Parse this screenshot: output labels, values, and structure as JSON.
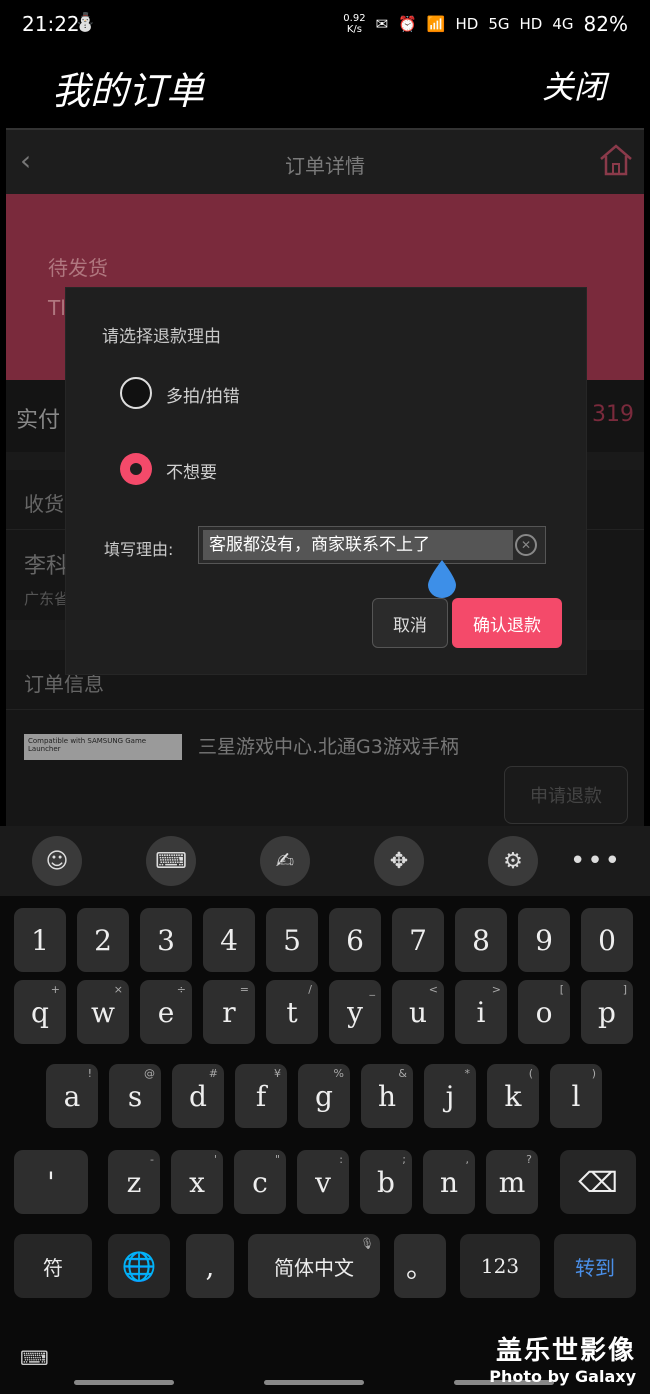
{
  "status_bar": {
    "time": "21:22",
    "speed_value": "0.92",
    "speed_unit": "K/s",
    "hd1": "HD",
    "net1": "5G",
    "hd2": "HD",
    "net2": "4G",
    "battery": "82%"
  },
  "header": {
    "title": "我的订单",
    "close_label": "关闭"
  },
  "page": {
    "nav_title": "订单详情",
    "order_status": "待发货",
    "order_status_sub": "Tl",
    "paid_label": "实付",
    "paid_value": "319",
    "address_heading": "收货",
    "address_name": "李科",
    "address_line": "广东省",
    "order_info_heading": "订单信息",
    "product_thumb_text": "Compatible with SAMSUNG Game Launcher",
    "product_name": "三星游戏中心.北通G3游戏手柄",
    "apply_refund_label": "申请退款"
  },
  "dialog": {
    "title": "请选择退款理由",
    "options": [
      {
        "label": "多拍/拍错",
        "selected": false
      },
      {
        "label": "不想要",
        "selected": true
      }
    ],
    "reason_label": "填写理由:",
    "reason_value": "客服都没有，商家联系不上了",
    "cancel_label": "取消",
    "confirm_label": "确认退款",
    "accent_color": "#f44a6a"
  },
  "keyboard_toolbar": {
    "icons": [
      "emoji-icon",
      "keyboard-icon",
      "handwriting-icon",
      "cursor-move-icon",
      "settings-icon",
      "more-icon"
    ]
  },
  "keyboard": {
    "row_numbers": [
      "1",
      "2",
      "3",
      "4",
      "5",
      "6",
      "7",
      "8",
      "9",
      "0"
    ],
    "row_top": [
      {
        "k": "q",
        "h": "+"
      },
      {
        "k": "w",
        "h": "×"
      },
      {
        "k": "e",
        "h": "÷"
      },
      {
        "k": "r",
        "h": "="
      },
      {
        "k": "t",
        "h": "/"
      },
      {
        "k": "y",
        "h": "_"
      },
      {
        "k": "u",
        "h": "<"
      },
      {
        "k": "i",
        "h": ">"
      },
      {
        "k": "o",
        "h": "["
      },
      {
        "k": "p",
        "h": "]"
      }
    ],
    "row_mid": [
      {
        "k": "a",
        "h": "!"
      },
      {
        "k": "s",
        "h": "@"
      },
      {
        "k": "d",
        "h": "#"
      },
      {
        "k": "f",
        "h": "¥"
      },
      {
        "k": "g",
        "h": "%"
      },
      {
        "k": "h",
        "h": "&"
      },
      {
        "k": "j",
        "h": "*"
      },
      {
        "k": "k",
        "h": "("
      },
      {
        "k": "l",
        "h": ")"
      }
    ],
    "row_bot": [
      {
        "k": "'",
        "h": ""
      },
      {
        "k": "z",
        "h": "-"
      },
      {
        "k": "x",
        "h": "'"
      },
      {
        "k": "c",
        "h": "\""
      },
      {
        "k": "v",
        "h": ":"
      },
      {
        "k": "b",
        "h": ";"
      },
      {
        "k": "n",
        "h": ","
      },
      {
        "k": "m",
        "h": "?"
      }
    ],
    "symbol_key": "符",
    "space_label": "简体中文",
    "comma_key": ",",
    "period_key": "。",
    "num_key": "123",
    "enter_label": "转到"
  },
  "watermark": {
    "main": "盖乐世影像",
    "sub": "Photo by Galaxy"
  }
}
